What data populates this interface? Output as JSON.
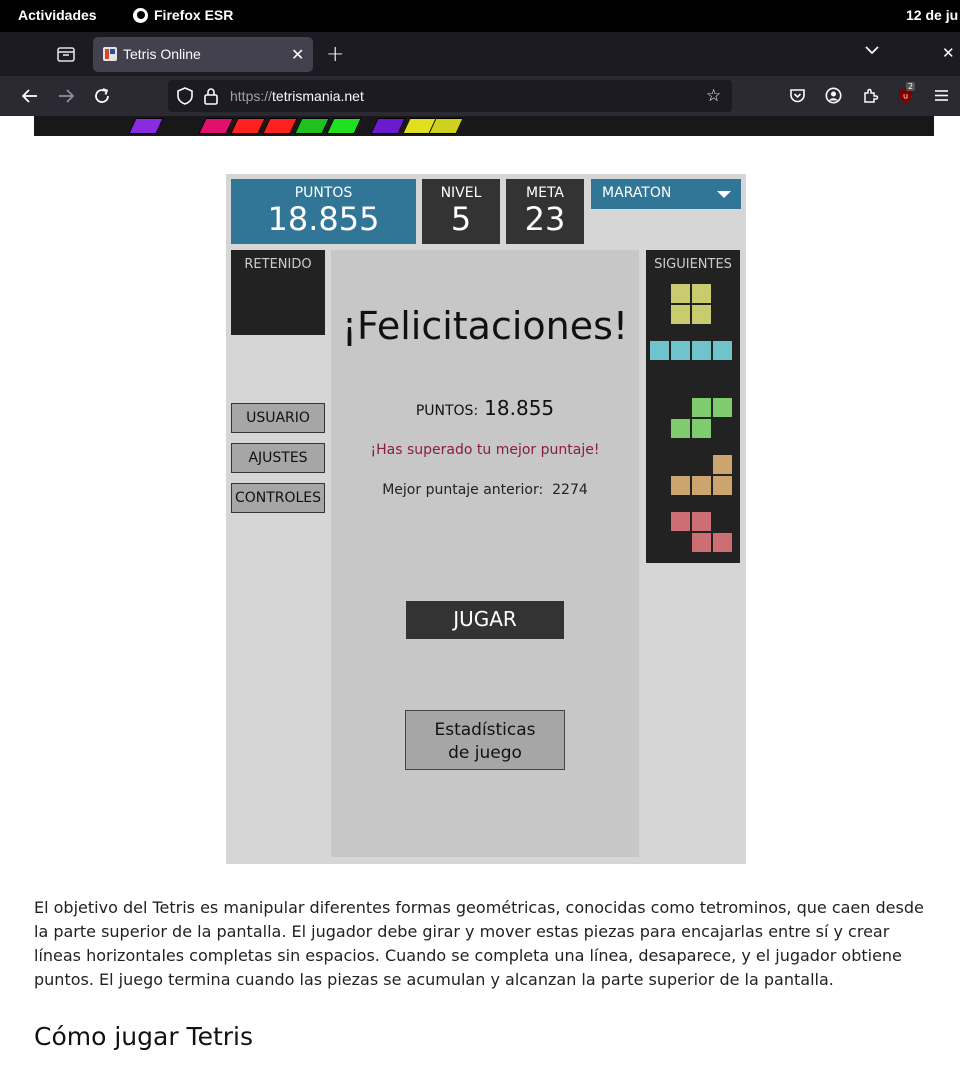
{
  "system": {
    "activities": "Actividades",
    "app_name": "Firefox ESR",
    "clock": "12 de ju"
  },
  "browser": {
    "tab_title": "Tetris Online",
    "url_protocol": "https://",
    "url_host": "tetrismania.net",
    "extension_badge": "2"
  },
  "game": {
    "score_label": "PUNTOS",
    "score_value": "18.855",
    "level_label": "NIVEL",
    "level_value": "5",
    "goal_label": "META",
    "goal_value": "23",
    "mode": "MARATON",
    "hold_label": "RETENIDO",
    "next_label": "SIGUIENTES",
    "menu": {
      "user": "USUARIO",
      "settings": "AJUSTES",
      "controls": "CONTROLES"
    },
    "congrats": "¡Felicitaciones!",
    "result_label": "PUNTOS:",
    "result_value": "18.855",
    "best_message": "¡Has superado tu mejor puntaje!",
    "prev_best_label": "Mejor puntaje anterior:",
    "prev_best_value": "2274",
    "play_button": "JUGAR",
    "stats_button_line1": "Estadísticas",
    "stats_button_line2": "de juego",
    "next_pieces": [
      {
        "type": "O",
        "color": "#c9cc6e"
      },
      {
        "type": "I",
        "color": "#6fc4cc"
      },
      {
        "type": "S",
        "color": "#7fcc6e"
      },
      {
        "type": "L",
        "color": "#cca46e"
      },
      {
        "type": "Z",
        "color": "#cc6e73"
      }
    ]
  },
  "article": {
    "paragraph": "El objetivo del Tetris es manipular diferentes formas geométricas, conocidas como tetrominos, que caen desde la parte superior de la pantalla. El jugador debe girar y mover estas piezas para encajarlas entre sí y crear líneas horizontales completas sin espacios. Cuando se completa una línea, desaparece, y el jugador obtiene puntos. El juego termina cuando las piezas se acumulan y alcanzan la parte superior de la pantalla.",
    "heading": "Cómo jugar Tetris"
  },
  "colors": {
    "accent": "#327697",
    "dark": "#333333",
    "success_text": "#8a1e3a"
  }
}
